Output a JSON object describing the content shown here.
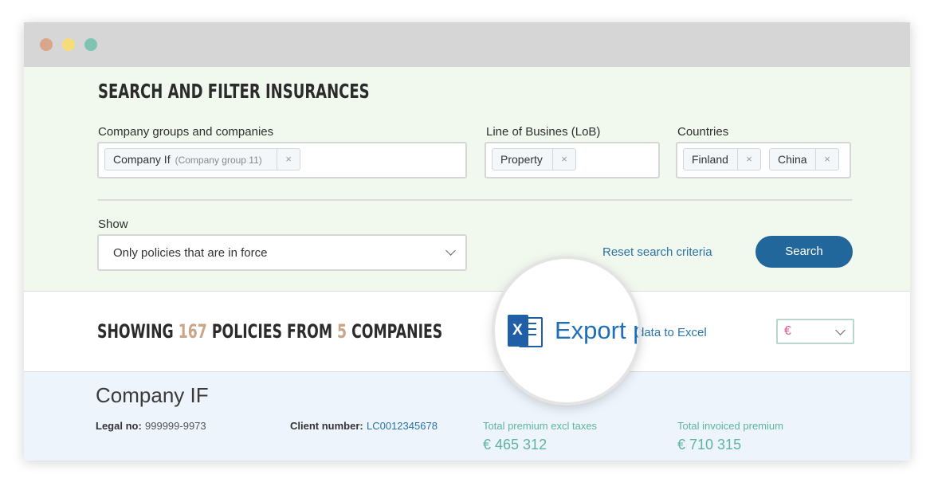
{
  "window": {
    "dots": [
      "#d8a68a",
      "#f7dd7a",
      "#7fc4b3"
    ]
  },
  "filter": {
    "title": "SEARCH AND FILTER INSURANCES",
    "company_label": "Company groups and companies",
    "company_tag": {
      "name": "Company If",
      "sub": "(Company group 11)"
    },
    "lob_label": "Line of Busines (LoB)",
    "lob_tag": "Property",
    "countries_label": "Countries",
    "country_tags": [
      "Finland",
      "China"
    ],
    "remove_symbol": "×",
    "show_label": "Show",
    "show_value": "Only policies that are in force",
    "reset_label": "Reset search criteria",
    "search_label": "Search"
  },
  "results": {
    "prefix": "SHOWING",
    "policies_count": "167",
    "middle": "POLICIES FROM",
    "companies_count": "5",
    "suffix": "COMPANIES",
    "export_small": "data to Excel",
    "export_zoom": "Export p",
    "excel_letter": "X",
    "currency_symbol": "€"
  },
  "company": {
    "name": "Company IF",
    "legal_label": "Legal no:",
    "legal_value": "999999-9973",
    "client_label": "Client number:",
    "client_value": "LC0012345678",
    "premium_label": "Total premium excl taxes",
    "premium_value": "€ 465 312",
    "invoiced_label": "Total invoiced premium",
    "invoiced_value": "€ 710 315"
  },
  "colors": {
    "accent": "#c9a58a",
    "button": "#21679b",
    "link": "#2a73a8",
    "teal": "#5fb3a6",
    "filter_bg": "#f1f8ee",
    "company_bg": "#edf4fb"
  }
}
